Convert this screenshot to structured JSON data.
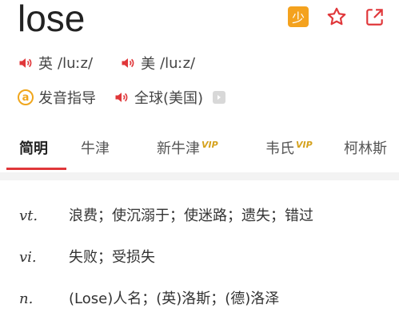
{
  "header": {
    "word": "lose"
  },
  "top_actions": {
    "badge_label": "少",
    "icons": [
      "youdao-badge-icon",
      "star-icon",
      "share-icon"
    ]
  },
  "pronunciation": [
    {
      "region": "英",
      "ipa": "/luːz/"
    },
    {
      "region": "美",
      "ipa": "/luːz/"
    }
  ],
  "row2": {
    "guide_label": "发音指导",
    "global_label": "全球(美国)"
  },
  "tabs": [
    {
      "label": "简明",
      "vip": ""
    },
    {
      "label": "牛津",
      "vip": ""
    },
    {
      "label": "新牛津",
      "vip": "VIP"
    },
    {
      "label": "韦氏",
      "vip": "VIP"
    },
    {
      "label": "柯林斯",
      "vip": ""
    }
  ],
  "definitions": [
    {
      "pos": "vt.",
      "text": "浪费；使沉溺于；使迷路；遗失；错过"
    },
    {
      "pos": "vi.",
      "text": "失败；受损失"
    },
    {
      "pos": "n.",
      "text": "(Lose)人名；(英)洛斯；(德)洛泽"
    }
  ],
  "colors": {
    "accent": "#e0373a",
    "badge": "#f4a21e",
    "vip": "#d5a21d"
  }
}
